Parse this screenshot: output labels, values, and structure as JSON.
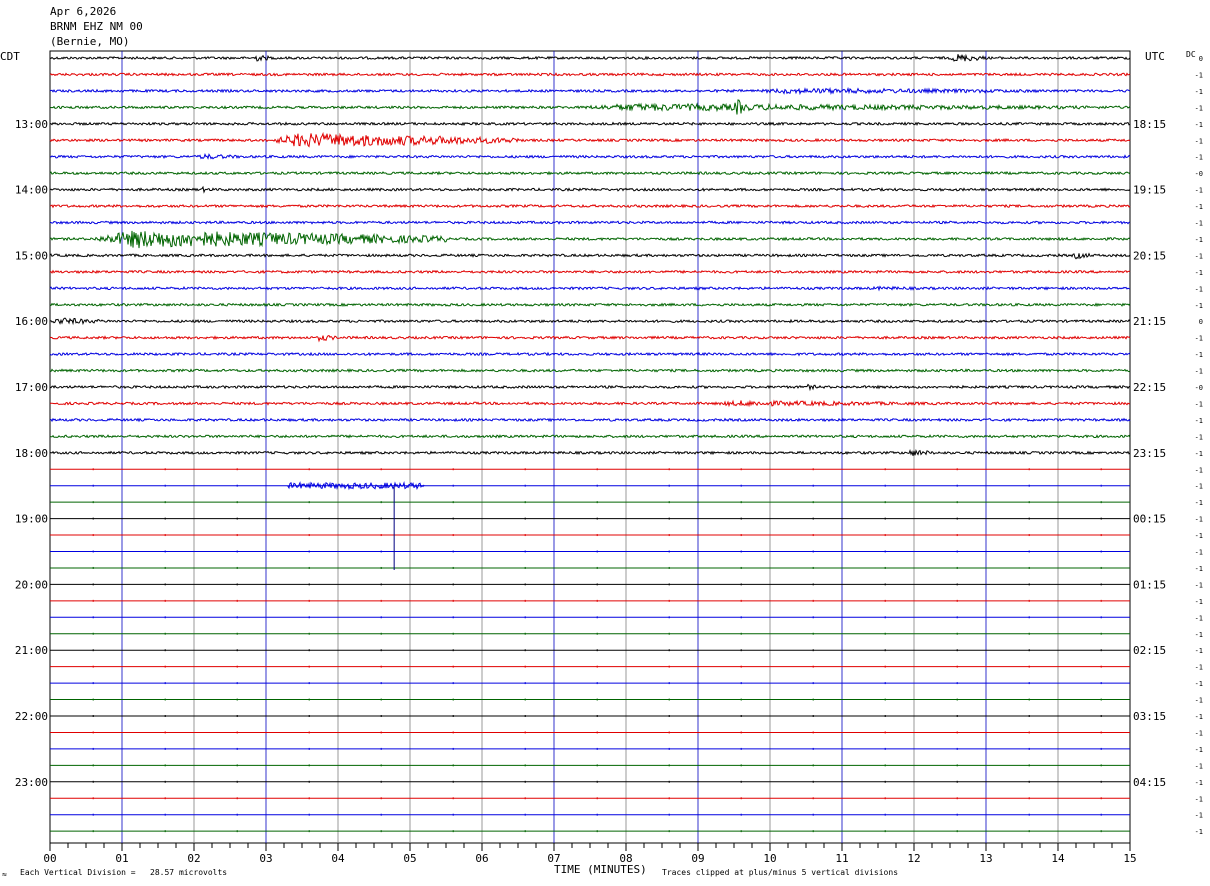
{
  "header": {
    "date": "Apr 6,2026",
    "station": "BRNM EHZ NM 00",
    "location": "(Bernie, MO)"
  },
  "labels": {
    "left_zone": "CDT",
    "right_zone": "UTC",
    "dc_header": "DC",
    "x_axis_title": "TIME (MINUTES)",
    "scale_note": "Each Vertical Division =   28.57 microvolts",
    "clip_note": "Traces clipped at plus/minus 5 vertical divisions"
  },
  "colors": {
    "trace_cycle": [
      "#000000",
      "#e00000",
      "#0000e0",
      "#006400"
    ],
    "grid_minor": "#808080",
    "grid_blue": "#0000c0"
  },
  "chart_data": {
    "type": "line",
    "x": {
      "label": "TIME (MINUTES)",
      "range": [
        0,
        15
      ],
      "ticks": [
        "00",
        "01",
        "02",
        "03",
        "04",
        "05",
        "06",
        "07",
        "08",
        "09",
        "10",
        "11",
        "12",
        "13",
        "14",
        "15"
      ]
    },
    "rows_per_hour": 4,
    "row_count": 48,
    "left_hour_labels": [
      "13:00",
      "14:00",
      "15:00",
      "16:00",
      "17:00",
      "18:00",
      "19:00",
      "20:00",
      "21:00",
      "22:00",
      "23:00"
    ],
    "right_hour_labels": [
      "18:15",
      "19:15",
      "20:15",
      "21:15",
      "22:15",
      "23:15",
      "00:15",
      "01:15",
      "02:15",
      "03:15",
      "04:15"
    ],
    "dc_offsets": [
      "0",
      "-1",
      "-1",
      "-1",
      "-1",
      "-1",
      "-1",
      "-0",
      "-1",
      "-1",
      "-1",
      "-1",
      "-1",
      "-1",
      "-1",
      "-1",
      "0",
      "-1",
      "-1",
      "-1",
      "-0",
      "-1",
      "-1",
      "-1",
      "-1",
      "-1",
      "-1",
      "-1",
      "-1",
      "-1",
      "-1",
      "-1",
      "-1",
      "-1",
      "-1",
      "-1",
      "-1",
      "-1",
      "-1",
      "-1",
      "-1",
      "-1",
      "-1",
      "-1",
      "-1",
      "-1",
      "-1",
      "-1"
    ],
    "data_rows_recorded": 25,
    "events": [
      {
        "row": 0,
        "start_min": 2.8,
        "end_min": 3.1,
        "amp": 4
      },
      {
        "row": 0,
        "start_min": 12.5,
        "end_min": 13.0,
        "amp": 5
      },
      {
        "row": 2,
        "start_min": 9.5,
        "end_min": 15.0,
        "amp": 3
      },
      {
        "row": 3,
        "start_min": 7.0,
        "end_min": 15.0,
        "amp": 4
      },
      {
        "row": 3,
        "start_min": 9.5,
        "end_min": 9.7,
        "amp": 10
      },
      {
        "row": 5,
        "start_min": 3.0,
        "end_min": 6.5,
        "amp": 8
      },
      {
        "row": 6,
        "start_min": 2.0,
        "end_min": 2.8,
        "amp": 3
      },
      {
        "row": 8,
        "start_min": 2.1,
        "end_min": 2.3,
        "amp": 3
      },
      {
        "row": 11,
        "start_min": 0.5,
        "end_min": 5.5,
        "amp": 10
      },
      {
        "row": 12,
        "start_min": 14.2,
        "end_min": 14.5,
        "amp": 4
      },
      {
        "row": 14,
        "start_min": 11.3,
        "end_min": 12.7,
        "amp": 2
      },
      {
        "row": 16,
        "start_min": 0.0,
        "end_min": 0.8,
        "amp": 4
      },
      {
        "row": 17,
        "start_min": 3.7,
        "end_min": 4.0,
        "amp": 4
      },
      {
        "row": 20,
        "start_min": 10.5,
        "end_min": 10.7,
        "amp": 3
      },
      {
        "row": 21,
        "start_min": 9.0,
        "end_min": 13.0,
        "amp": 3
      },
      {
        "row": 24,
        "start_min": 11.9,
        "end_min": 12.3,
        "amp": 4
      }
    ],
    "fragment": {
      "row": 26,
      "start_min": 3.3,
      "end_min": 5.2,
      "amp": 3,
      "spike_min": 4.78
    }
  }
}
